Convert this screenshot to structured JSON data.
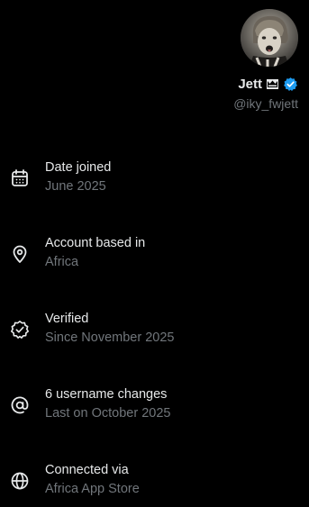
{
  "profile": {
    "display_name": "Jett",
    "handle": "@iky_fwjett",
    "badges": [
      "crown-emoji-icon",
      "verified-badge-icon"
    ],
    "verified_color": "#1d9bf0"
  },
  "about": {
    "items": [
      {
        "icon": "calendar-icon",
        "title": "Date joined",
        "subtitle": "June 2025"
      },
      {
        "icon": "location-pin-icon",
        "title": "Account based in",
        "subtitle": "Africa"
      },
      {
        "icon": "verified-check-icon",
        "title": "Verified",
        "subtitle": "Since November 2025"
      },
      {
        "icon": "at-sign-icon",
        "title": "6 username changes",
        "subtitle": "Last on October 2025"
      },
      {
        "icon": "globe-icon",
        "title": "Connected via",
        "subtitle": "Africa App Store"
      }
    ]
  },
  "colors": {
    "background": "#000000",
    "primary_text": "#e7e9ea",
    "secondary_text": "#71767b"
  }
}
